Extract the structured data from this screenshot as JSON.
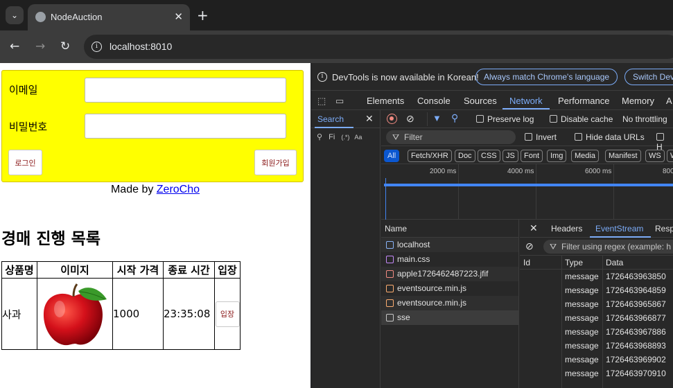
{
  "browser": {
    "tab_title": "NodeAuction",
    "url": "localhost:8010"
  },
  "page": {
    "email_label": "이메일",
    "password_label": "비밀번호",
    "login_button": "로그인",
    "join_button": "회원가입",
    "made_by_prefix": "Made by ",
    "made_by_link": "ZeroCho",
    "heading": "경매 진행 목록",
    "table": {
      "headers": [
        "상품명",
        "이미지",
        "시작 가격",
        "종료 시간",
        "입장"
      ],
      "rows": [
        {
          "name": "사과",
          "price": "1000",
          "end_time": "23:35:08",
          "enter": "입장"
        }
      ]
    }
  },
  "devtools": {
    "banner_message": "DevTools is now available in Korean!",
    "banner_button1": "Always match Chrome's language",
    "banner_button2": "Switch Dev",
    "tabs": [
      "Elements",
      "Console",
      "Sources",
      "Network",
      "Performance",
      "Memory",
      "A"
    ],
    "active_tab": "Network",
    "search_tab": "Search",
    "search_row_text": "Fi",
    "search_regex": "(.*)",
    "search_case": "Aa",
    "preserve_log": "Preserve log",
    "disable_cache": "Disable cache",
    "throttling": "No throttling",
    "filter_placeholder": "Filter",
    "invert": "Invert",
    "hide_data_urls": "Hide data URLs",
    "hide_ext": "H",
    "type_filters": [
      "All",
      "Fetch/XHR",
      "Doc",
      "CSS",
      "JS",
      "Font",
      "Img",
      "Media",
      "Manifest",
      "WS",
      "W"
    ],
    "timeline_labels": [
      "2000 ms",
      "4000 ms",
      "6000 ms",
      "800"
    ],
    "name_header": "Name",
    "requests": [
      {
        "name": "localhost",
        "icon_color": "#8ab4f8"
      },
      {
        "name": "main.css",
        "icon_color": "#c58af9"
      },
      {
        "name": "apple1726462487223.jfif",
        "icon_color": "#f28b82"
      },
      {
        "name": "eventsource.min.js",
        "icon_color": "#fcad70"
      },
      {
        "name": "eventsource.min.js",
        "icon_color": "#fcad70"
      },
      {
        "name": "sse",
        "icon_color": "#c7c7c7"
      }
    ],
    "detail_tabs": [
      "Headers",
      "EventStream",
      "Resp"
    ],
    "regex_filter": "Filter using regex (example: h",
    "es_columns": [
      "Id",
      "Type",
      "Data"
    ],
    "events": [
      {
        "type": "message",
        "data": "1726463963850"
      },
      {
        "type": "message",
        "data": "1726463964859"
      },
      {
        "type": "message",
        "data": "1726463965867"
      },
      {
        "type": "message",
        "data": "1726463966877"
      },
      {
        "type": "message",
        "data": "1726463967886"
      },
      {
        "type": "message",
        "data": "1726463968893"
      },
      {
        "type": "message",
        "data": "1726463969902"
      },
      {
        "type": "message",
        "data": "1726463970910"
      }
    ]
  },
  "colors": {
    "login_bg": "#ffff00",
    "devtools_accent": "#7cacf8"
  }
}
